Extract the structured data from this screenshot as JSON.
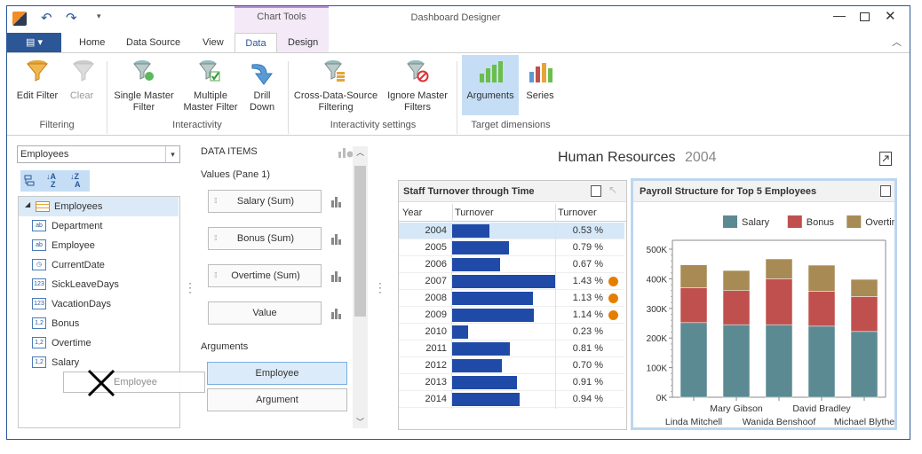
{
  "titlebar": {
    "title": "Dashboard Designer",
    "context_tab": "Chart Tools"
  },
  "tabs": [
    "Home",
    "Data Source",
    "View",
    "Data",
    "Design"
  ],
  "ribbon": {
    "buttons": {
      "edit_filter": "Edit Filter",
      "clear": "Clear",
      "single_master": "Single Master\nFilter",
      "multiple_master": "Multiple\nMaster Filter",
      "drill_down": "Drill\nDown",
      "cross_ds": "Cross-Data-Source\nFiltering",
      "ignore_master": "Ignore Master\nFilters",
      "arguments": "Arguments",
      "series": "Series"
    },
    "groups": {
      "filtering": "Filtering",
      "interactivity": "Interactivity",
      "interactivity_settings": "Interactivity settings",
      "target_dimensions": "Target dimensions"
    }
  },
  "datasource": {
    "selected": "Employees",
    "root": "Employees",
    "fields": [
      {
        "label": "Department",
        "icon": "ab"
      },
      {
        "label": "Employee",
        "icon": "ab"
      },
      {
        "label": "CurrentDate",
        "icon": "clock"
      },
      {
        "label": "SickLeaveDays",
        "icon": "123"
      },
      {
        "label": "VacationDays",
        "icon": "123"
      },
      {
        "label": "Bonus",
        "icon": "1,2"
      },
      {
        "label": "Overtime",
        "icon": "1,2"
      },
      {
        "label": "Salary",
        "icon": "1,2"
      }
    ],
    "drag_ghost": "Employee"
  },
  "data_items": {
    "header": "DATA ITEMS",
    "values_label": "Values (Pane 1)",
    "values": [
      "Salary (Sum)",
      "Bonus (Sum)",
      "Overtime (Sum)"
    ],
    "value_placeholder": "Value",
    "arguments_label": "Arguments",
    "arguments": [
      "Employee"
    ],
    "argument_placeholder": "Argument"
  },
  "dashboard": {
    "title": "Human Resources",
    "year": "2004"
  },
  "grid": {
    "title": "Staff Turnover through Time",
    "columns": [
      "Year",
      "Turnover",
      "Turnover"
    ],
    "rows": [
      {
        "year": "2004",
        "value": 0.53,
        "text": "0.53 %",
        "flag": false
      },
      {
        "year": "2005",
        "value": 0.79,
        "text": "0.79 %",
        "flag": false
      },
      {
        "year": "2006",
        "value": 0.67,
        "text": "0.67 %",
        "flag": false
      },
      {
        "year": "2007",
        "value": 1.43,
        "text": "1.43 %",
        "flag": true
      },
      {
        "year": "2008",
        "value": 1.13,
        "text": "1.13 %",
        "flag": true
      },
      {
        "year": "2009",
        "value": 1.14,
        "text": "1.14 %",
        "flag": true
      },
      {
        "year": "2010",
        "value": 0.23,
        "text": "0.23 %",
        "flag": false
      },
      {
        "year": "2011",
        "value": 0.81,
        "text": "0.81 %",
        "flag": false
      },
      {
        "year": "2012",
        "value": 0.7,
        "text": "0.70 %",
        "flag": false
      },
      {
        "year": "2013",
        "value": 0.91,
        "text": "0.91 %",
        "flag": false
      },
      {
        "year": "2014",
        "value": 0.94,
        "text": "0.94 %",
        "flag": false
      }
    ]
  },
  "chart_data": {
    "type": "bar",
    "title": "Payroll Structure for Top 5 Employees",
    "stacked": true,
    "categories": [
      "Linda Mitchell",
      "Mary Gibson",
      "Wanida Benshoof",
      "David Bradley",
      "Michael Blythe"
    ],
    "series": [
      {
        "name": "Salary",
        "color": "#5b8a92",
        "values": [
          252000,
          245000,
          245000,
          240000,
          222000
        ]
      },
      {
        "name": "Bonus",
        "color": "#c0504d",
        "values": [
          118000,
          115000,
          155000,
          118000,
          118000
        ]
      },
      {
        "name": "Overtime",
        "color": "#a88a55",
        "values": [
          77000,
          68000,
          67000,
          88000,
          58000
        ]
      }
    ],
    "yticks": [
      "0K",
      "100K",
      "200K",
      "300K",
      "400K",
      "500K"
    ],
    "ylim": [
      0,
      500000
    ],
    "legend": "top-right",
    "grid": false
  }
}
